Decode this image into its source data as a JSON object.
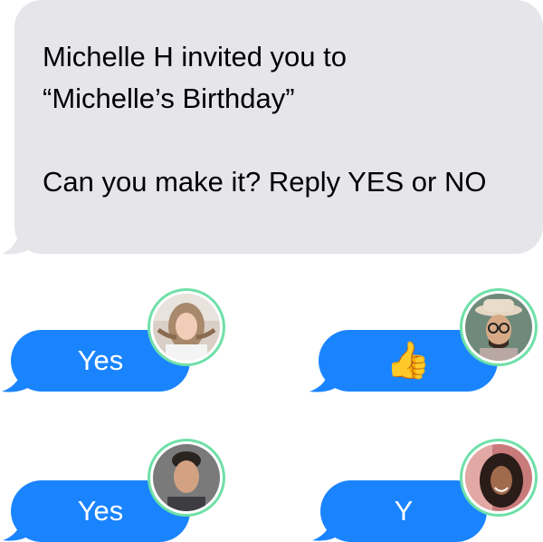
{
  "invite_message": {
    "line1": "Michelle H invited you to",
    "line2": "“Michelle’s Birthday”",
    "line3": "Can you make it? Reply YES or NO"
  },
  "replies": [
    {
      "text": "Yes",
      "avatar": "woman-blonde-avatar"
    },
    {
      "text": "👍",
      "avatar": "man-hat-glasses-avatar"
    },
    {
      "text": "Yes",
      "avatar": "man-dark-hair-avatar"
    },
    {
      "text": "Y",
      "avatar": "woman-curly-hair-avatar"
    }
  ],
  "colors": {
    "incoming_bubble": "#e5e5ea",
    "reply_bubble": "#1a84ff",
    "avatar_ring": "#6fe0a8"
  }
}
